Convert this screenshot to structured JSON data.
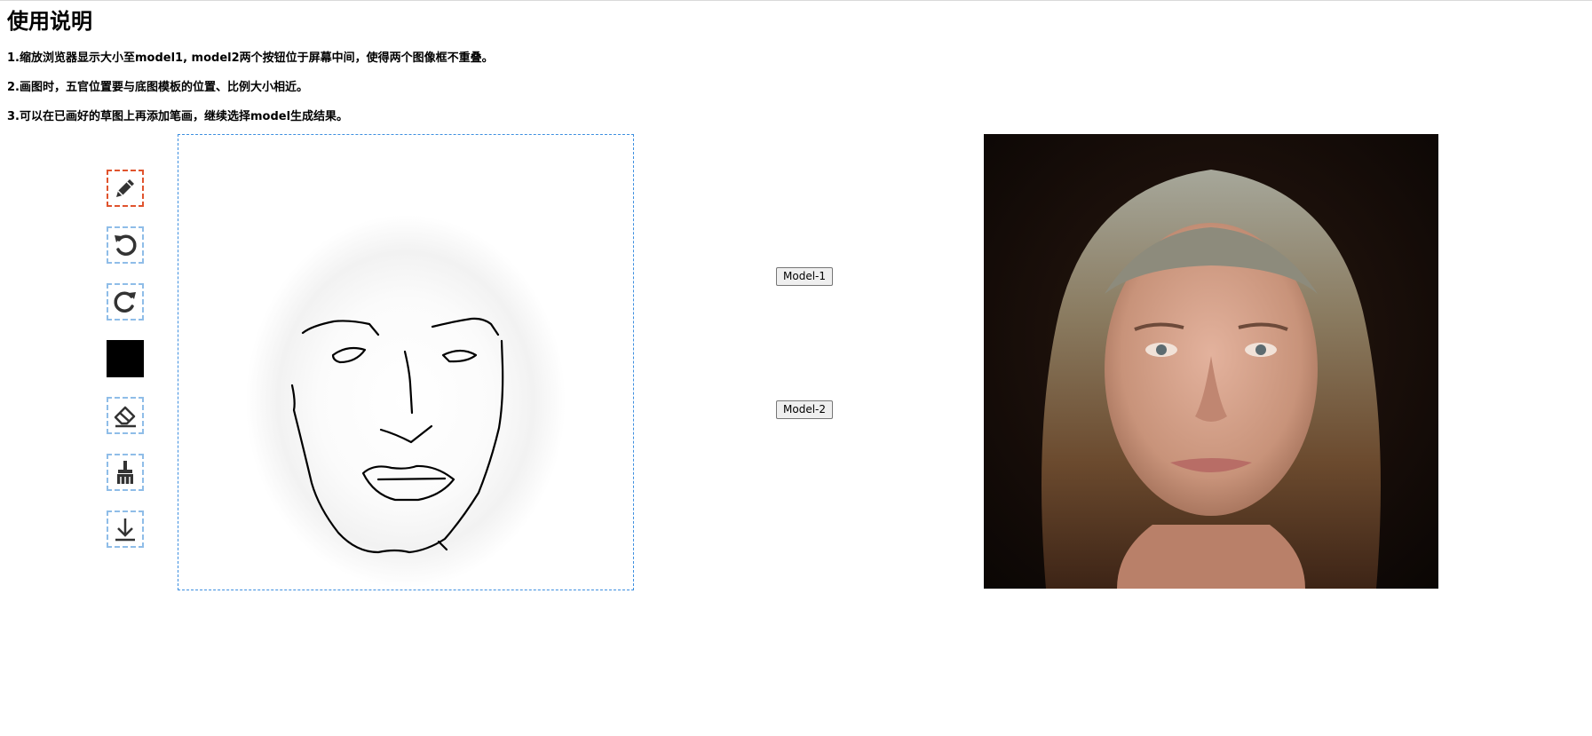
{
  "page": {
    "title": "使用说明",
    "instructions": [
      "1.缩放浏览器显示大小至model1, model2两个按钮位于屏幕中间，使得两个图像框不重叠。",
      "2.画图时，五官位置要与底图模板的位置、比例大小相近。",
      "3.可以在已画好的草图上再添加笔画，继续选择model生成结果。"
    ]
  },
  "toolbar": {
    "tools": [
      {
        "name": "pencil",
        "icon": "pencil-icon",
        "active": true
      },
      {
        "name": "undo",
        "icon": "undo-icon",
        "active": false
      },
      {
        "name": "redo",
        "icon": "redo-icon",
        "active": false
      },
      {
        "name": "color",
        "icon": "color-swatch",
        "active": false,
        "color": "#000000"
      },
      {
        "name": "eraser",
        "icon": "eraser-icon",
        "active": false
      },
      {
        "name": "clear",
        "icon": "broom-icon",
        "active": false
      },
      {
        "name": "download",
        "icon": "download-icon",
        "active": false
      }
    ]
  },
  "models": {
    "model1_label": "Model-1",
    "model2_label": "Model-2"
  },
  "colors": {
    "active_tool_border": "#e0542e",
    "tool_border": "#8fbde8",
    "canvas_border": "#3d8fe0",
    "stroke_color": "#000000"
  }
}
